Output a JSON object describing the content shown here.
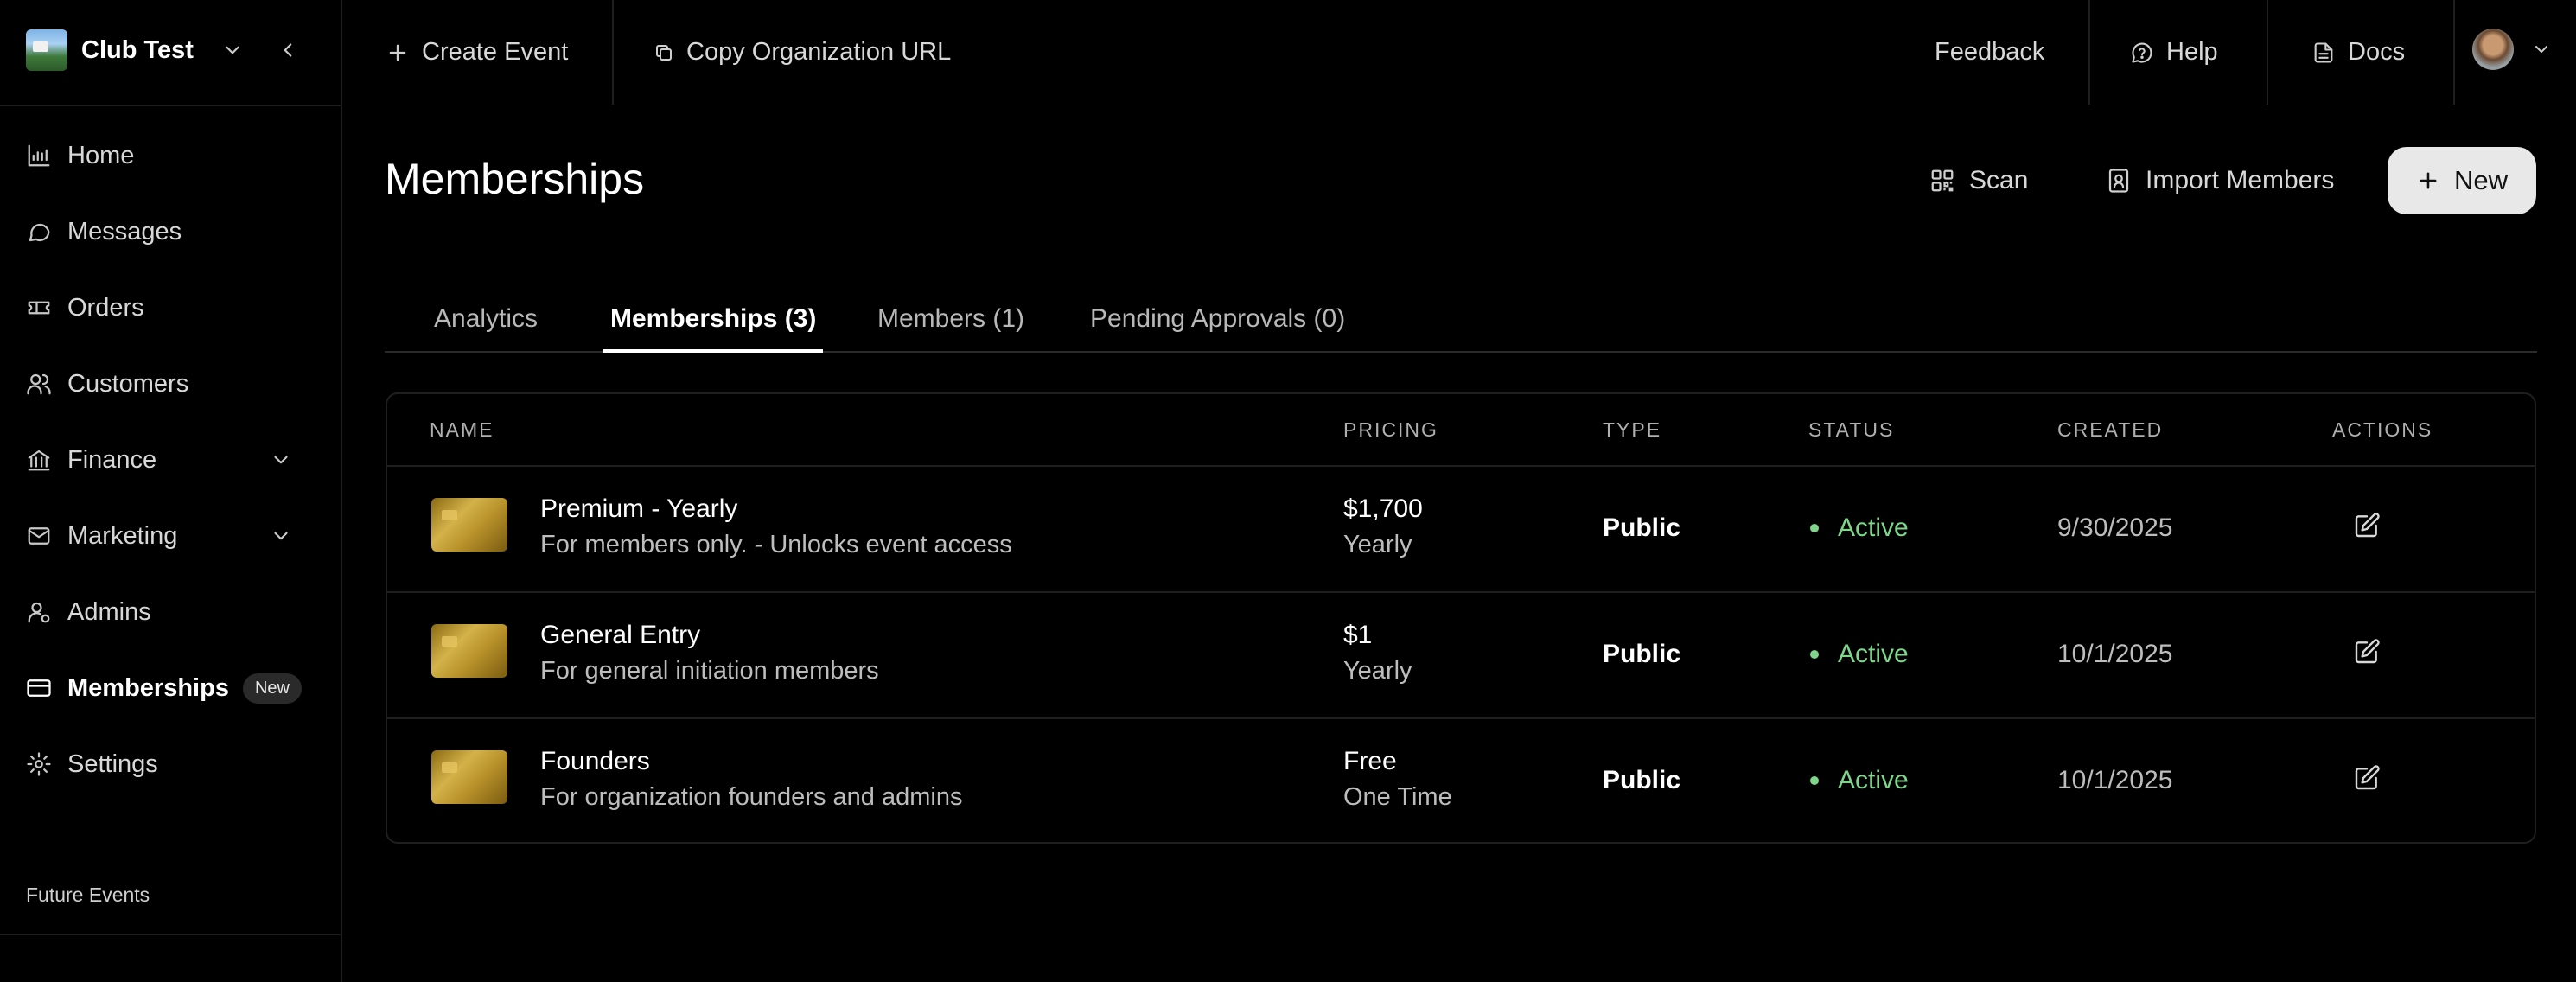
{
  "brand": {
    "name": "Club Test"
  },
  "header": {
    "create_event": "Create Event",
    "copy_url": "Copy Organization URL",
    "feedback": "Feedback",
    "help": "Help",
    "docs": "Docs"
  },
  "sidebar": {
    "items": [
      {
        "label": "Home",
        "icon": "chart-icon"
      },
      {
        "label": "Messages",
        "icon": "message-icon"
      },
      {
        "label": "Orders",
        "icon": "ticket-icon"
      },
      {
        "label": "Customers",
        "icon": "users-icon"
      },
      {
        "label": "Finance",
        "icon": "bank-icon",
        "expandable": true
      },
      {
        "label": "Marketing",
        "icon": "mail-icon",
        "expandable": true
      },
      {
        "label": "Admins",
        "icon": "admin-icon"
      },
      {
        "label": "Memberships",
        "icon": "card-icon",
        "badge": "New",
        "active": true
      },
      {
        "label": "Settings",
        "icon": "gear-icon"
      }
    ],
    "future_events": "Future Events"
  },
  "page": {
    "title": "Memberships",
    "scan": "Scan",
    "import_members": "Import Members",
    "new": "New"
  },
  "tabs": [
    {
      "label": "Analytics",
      "active": false
    },
    {
      "label": "Memberships (3)",
      "active": true
    },
    {
      "label": "Members (1)",
      "active": false
    },
    {
      "label": "Pending Approvals (0)",
      "active": false
    }
  ],
  "table": {
    "columns": [
      "NAME",
      "PRICING",
      "TYPE",
      "STATUS",
      "CREATED",
      "ACTIONS"
    ],
    "rows": [
      {
        "name": "Premium - Yearly",
        "description": "For members only. - Unlocks event access",
        "price": "$1,700",
        "period": "Yearly",
        "type": "Public",
        "status": "Active",
        "created": "9/30/2025"
      },
      {
        "name": "General Entry",
        "description": "For general initiation members",
        "price": "$1",
        "period": "Yearly",
        "type": "Public",
        "status": "Active",
        "created": "10/1/2025"
      },
      {
        "name": "Founders",
        "description": "For organization founders and admins",
        "price": "Free",
        "period": "One Time",
        "type": "Public",
        "status": "Active",
        "created": "10/1/2025"
      }
    ]
  },
  "colors": {
    "background": "#000000",
    "status_active": "#7ed68a",
    "new_button_bg": "#e8e8e8"
  }
}
